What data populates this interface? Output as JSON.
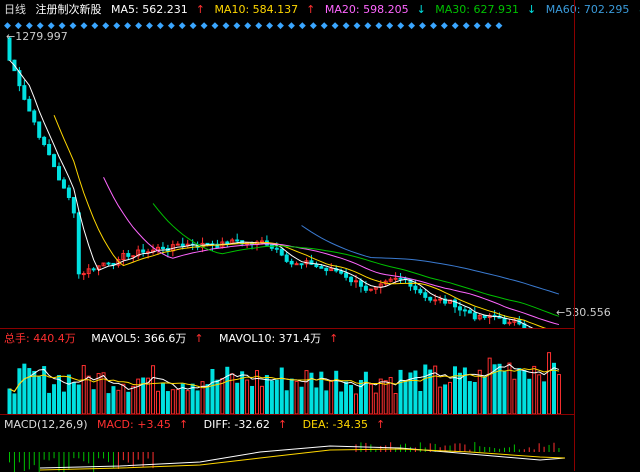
{
  "price_legend": {
    "period": "日线",
    "name": "注册制次新股",
    "ma5": "MA5: 562.231",
    "ma10": "MA10: 584.137",
    "ma20": "MA20: 598.205",
    "ma30": "MA30: 627.931",
    "ma60": "MA60: 702.295",
    "arrow_up": "↑",
    "arrow_down": "↓"
  },
  "price_labels": {
    "high": "1279.997",
    "low": "530.556"
  },
  "volume_legend": {
    "total": "总手: 440.4万",
    "mavol5": "MAVOL5: 366.6万",
    "mavol10": "MAVOL10: 371.4万",
    "arrow_up": "↑"
  },
  "macd_legend": {
    "title": "MACD(12,26,9)",
    "macd": "MACD: +3.45",
    "diff": "DIFF: -32.62",
    "dea": "DEA: -34.35",
    "arrow_up": "↑"
  },
  "colors": {
    "up": "#ff3030",
    "down": "#00e0e0",
    "ma5": "#ffffff",
    "ma10": "#ffd700",
    "ma20": "#ff66ff",
    "ma30": "#00c000",
    "ma60": "#3a7ad0",
    "marker": "#3aa6ff"
  }
}
